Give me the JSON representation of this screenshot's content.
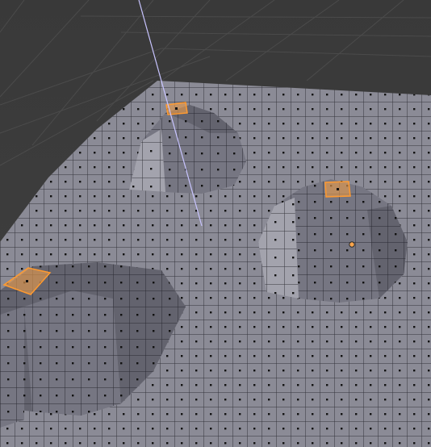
{
  "viewport": {
    "background_color": "#3d3d3d",
    "grid_line_color": "#4a4a4a",
    "mesh_face_color": "#8c8c97",
    "mesh_edge_color": "#2e2e36",
    "vertex_color": "#000000",
    "selected_face_color": "#f5a04a",
    "selected_edge_color": "#ff9a30",
    "active_object_origin_color": "#f7a44c",
    "lamp_line_color": "#c8c4ff"
  },
  "mesh": {
    "name": "",
    "mode": "edit",
    "selection_mode": "face",
    "selected_faces": 3
  }
}
